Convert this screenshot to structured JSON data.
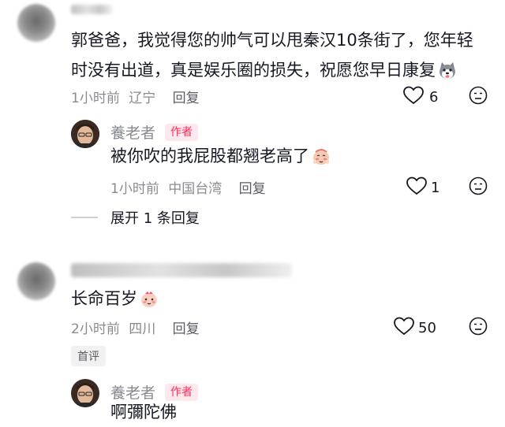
{
  "comments": [
    {
      "text": "郭爸爸，我觉得您的帅气可以甩秦汉10条街了，您年轻时没有出道，真是娱乐圈的损失，祝愿您早日康复",
      "line1": "郭爸爸，我觉得您的帅气可以甩秦汉10条街了，您年轻",
      "line2": "时没有出道，真是娱乐圈的损失，祝愿您早日康复",
      "emoji_icon": "husky-emoji-icon",
      "time": "1小时前",
      "location": "辽宁",
      "reply_label": "回复",
      "likes": "6",
      "reply": {
        "author": "養老者",
        "badge": "作者",
        "text": "被你吹的我屁股都翘老高了",
        "emoji_icon": "blushing-emoji-icon",
        "time": "1小时前",
        "location": "中国台湾",
        "reply_label": "回复",
        "likes": "1"
      },
      "expand_label": "展开 1 条回复"
    },
    {
      "text": "长命百岁",
      "emoji_icon": "bow-emoji-icon",
      "time": "2小时前",
      "location": "四川",
      "reply_label": "回复",
      "likes": "50",
      "tag": "首评",
      "reply": {
        "author": "養老者",
        "badge": "作者",
        "text": "啊彌陀佛"
      }
    }
  ],
  "colors": {
    "accent": "#fe2c55",
    "meta": "#8a8b91",
    "text": "#161823"
  }
}
